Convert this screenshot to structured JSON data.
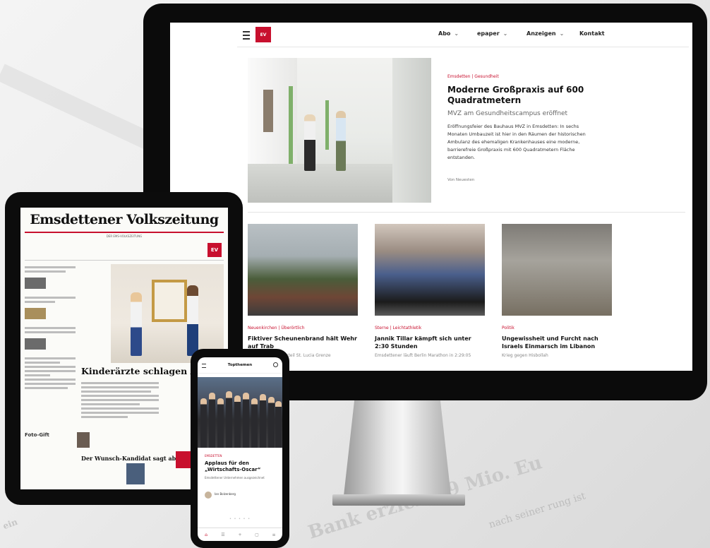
{
  "background": {
    "paper_headline": "Bank erzielt 19 Mio. Eu",
    "paper_fragment": "nach seiner rung ist",
    "paper_corner": "ein"
  },
  "monitor": {
    "logo": "EV",
    "nav": [
      {
        "label": "Abo"
      },
      {
        "label": "epaper"
      },
      {
        "label": "Anzeigen"
      },
      {
        "label": "Kontakt"
      }
    ],
    "hero": {
      "kicker": "Emsdetten | Gesundheit",
      "title": "Moderne Großpraxis auf 600 Quadratmetern",
      "subtitle": "MVZ am Gesundheitscampus eröffnet",
      "body": "Eröffnungsfeier des Bauhaus MVZ in Emsdetten: In sechs Monaten Umbauzeit ist hier in den Räumen der historischen Ambulanz des ehemaligen Krankenhauses eine moderne, barrierefreie Großpraxis mit 600 Quadratmetern Fläche entstanden.",
      "more": "Von Neuesten"
    },
    "cards": [
      {
        "kicker": "Neuenkirchen | Überörtlich",
        "title": "Fiktiver Scheunenbrand hält Wehr auf Trab",
        "sub": "Großübung im Ortsteil St. Lucia Grenze"
      },
      {
        "kicker": "Sterne | Leichtathletik",
        "title": "Jannik Tillar kämpft sich unter 2:30 Stunden",
        "sub": "Emsdettener läuft Berlin Marathon in 2:29:05"
      },
      {
        "kicker": "Politik",
        "title": "Ungewissheit und Furcht nach Israels Einmarsch im Libanon",
        "sub": "Krieg gegen Hisbollah"
      }
    ]
  },
  "tablet": {
    "masthead": "Emsdettener Volkszeitung",
    "masthead_sub": "DER EMS-VOLKSZEITUNG",
    "ev_logo": "EV",
    "headline": "Kinderärzte schlagen Alarm",
    "headline2": "Der Wunsch-Kandidat sagt ab",
    "sidebar_title": "Foto-Gift"
  },
  "phone": {
    "title": "Topthemen",
    "kicker": "EMSDETTEN",
    "headline": "Applaus für den „Wirtschafts-Oscar“",
    "teaser": "Emsdettener Unternehmen ausgezeichnet",
    "author": "Ian Bolzenberg",
    "dots": "• • • • •",
    "tabs": [
      "⌂",
      "☰",
      "+",
      "▢",
      "≡"
    ]
  }
}
